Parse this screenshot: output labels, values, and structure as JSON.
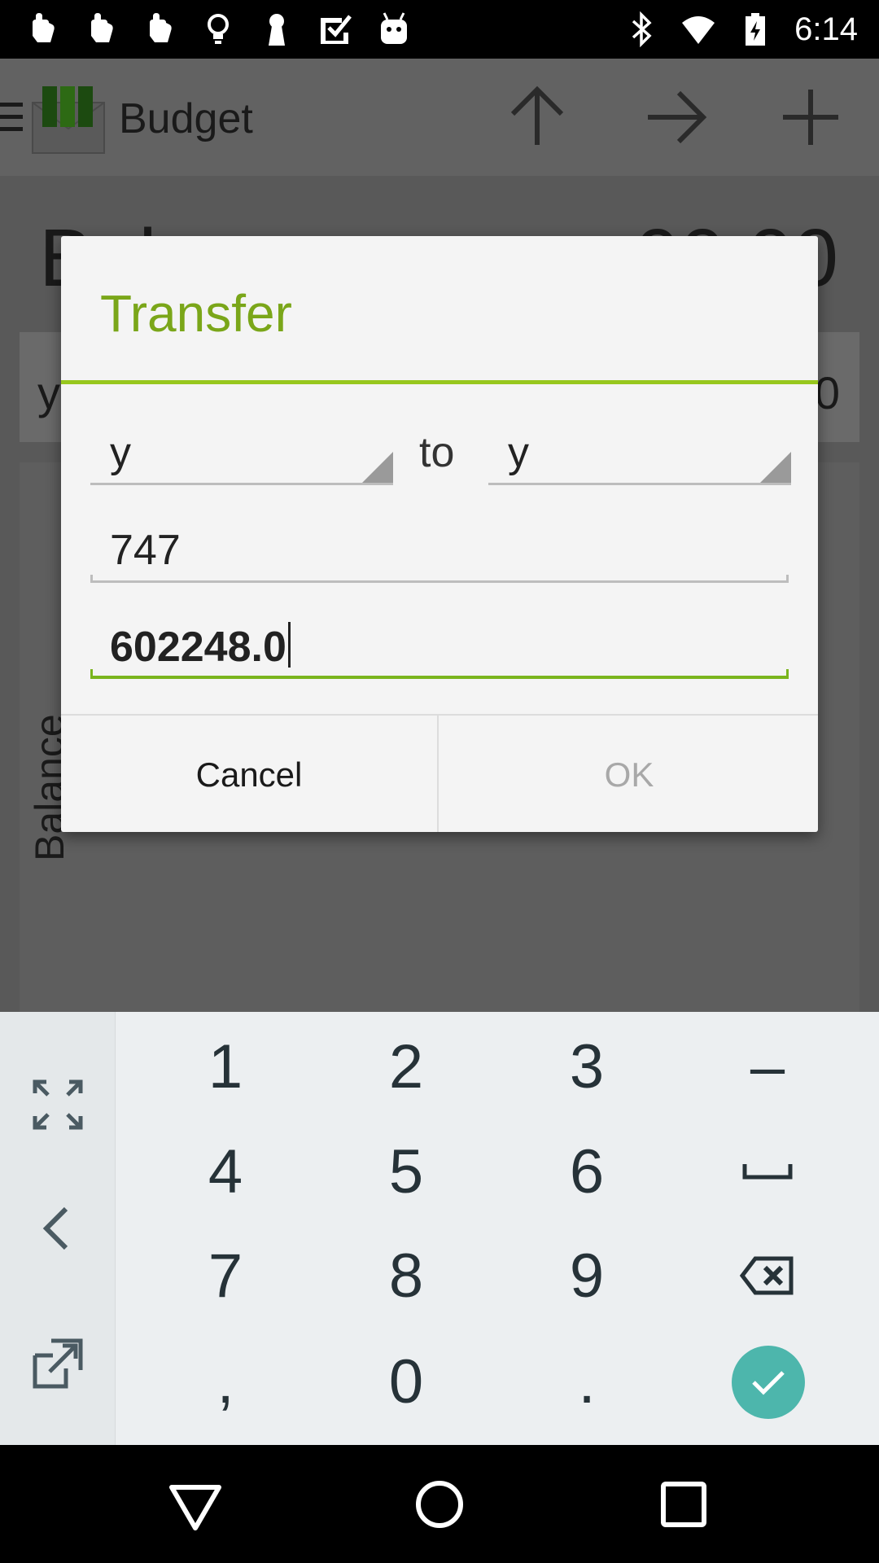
{
  "status_bar": {
    "time": "6:14",
    "left_icons": [
      "hand-notification-icon",
      "hand-notification-icon",
      "hand-notification-icon",
      "lightbulb-icon",
      "keyhole-icon",
      "checkbox-icon",
      "android-icon"
    ],
    "right_icons": [
      "bluetooth-icon",
      "wifi-icon",
      "battery-charging-icon"
    ]
  },
  "app_bar": {
    "title": "Budget",
    "actions": [
      "up-arrow-icon",
      "right-arrow-icon",
      "add-icon"
    ]
  },
  "background": {
    "balance_label": "Bal",
    "balance_value": "00.00",
    "row_left": "y",
    "row_right": "0",
    "chart_y_label": "Balance"
  },
  "dialog": {
    "title": "Transfer",
    "from_account": "y",
    "to_label": "to",
    "to_account": "y",
    "description": "747",
    "amount": "602248.0",
    "cancel_label": "Cancel",
    "ok_label": "OK"
  },
  "keyboard": {
    "keys": [
      [
        "1",
        "2",
        "3",
        "–"
      ],
      [
        "4",
        "5",
        "6",
        "␣"
      ],
      [
        "7",
        "8",
        "9",
        "⌫"
      ],
      [
        ",",
        "0",
        ".",
        "✓"
      ]
    ],
    "side_icons": [
      "fullscreen-icon",
      "back-chevron-icon",
      "popout-icon"
    ],
    "accent": "#4db6ac"
  },
  "colors": {
    "accent_green": "#7aa619",
    "dim_overlay": "#595959"
  }
}
